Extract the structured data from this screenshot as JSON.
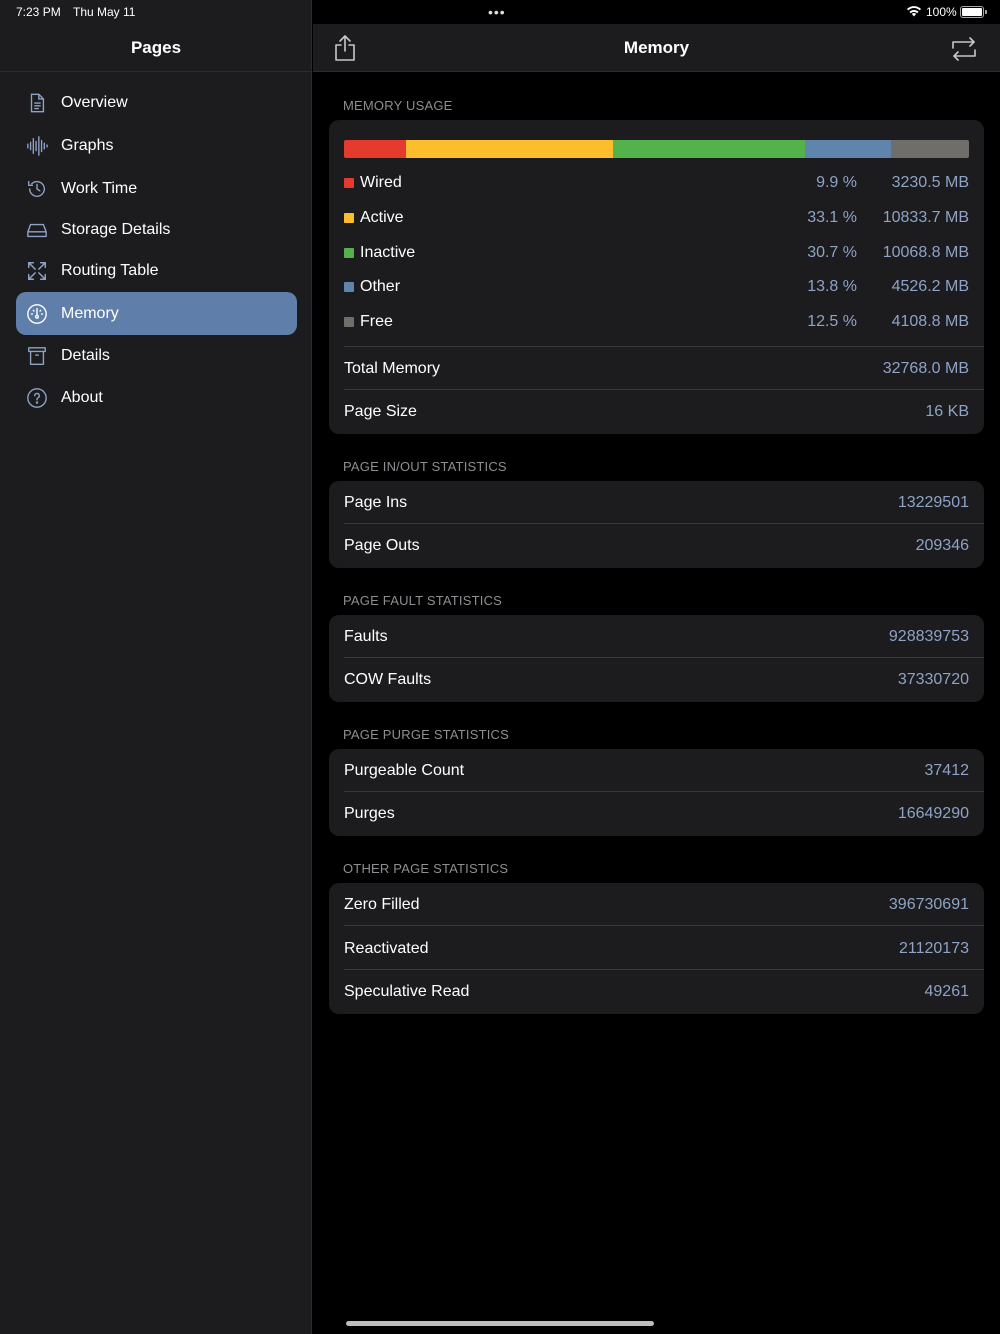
{
  "status_bar": {
    "time": "7:23 PM",
    "date": "Thu May 11",
    "battery": "100%"
  },
  "sidebar": {
    "title": "Pages",
    "items": [
      {
        "label": "Overview",
        "icon": "document-icon",
        "selected": false
      },
      {
        "label": "Graphs",
        "icon": "waveform-icon",
        "selected": false
      },
      {
        "label": "Work Time",
        "icon": "clock-history-icon",
        "selected": false
      },
      {
        "label": "Storage Details",
        "icon": "drive-icon",
        "selected": false
      },
      {
        "label": "Routing Table",
        "icon": "arrows-expand-icon",
        "selected": false
      },
      {
        "label": "Memory",
        "icon": "gauge-icon",
        "selected": true
      },
      {
        "label": "Details",
        "icon": "archive-box-icon",
        "selected": false
      },
      {
        "label": "About",
        "icon": "question-circle-icon",
        "selected": false
      }
    ]
  },
  "main": {
    "title": "Memory",
    "memory_usage": {
      "section": "MEMORY USAGE",
      "bar": [
        {
          "name": "Wired",
          "fraction": 0.099,
          "color": "#e53a2e"
        },
        {
          "name": "Active",
          "fraction": 0.331,
          "color": "#fcbe2d"
        },
        {
          "name": "Inactive",
          "fraction": 0.307,
          "color": "#53b24a"
        },
        {
          "name": "Other",
          "fraction": 0.138,
          "color": "#6085ad"
        },
        {
          "name": "Free",
          "fraction": 0.125,
          "color": "#6f6e6a"
        }
      ],
      "legend": [
        {
          "name": "Wired",
          "pct": "9.9 %",
          "mb": "3230.5 MB"
        },
        {
          "name": "Active",
          "pct": "33.1 %",
          "mb": "10833.7 MB"
        },
        {
          "name": "Inactive",
          "pct": "30.7 %",
          "mb": "10068.8 MB"
        },
        {
          "name": "Other",
          "pct": "13.8 %",
          "mb": "4526.2 MB"
        },
        {
          "name": "Free",
          "pct": "12.5 %",
          "mb": "4108.8 MB"
        }
      ],
      "total_label": "Total Memory",
      "total_value": "32768.0 MB",
      "page_size_label": "Page Size",
      "page_size_value": "16 KB"
    },
    "page_inout": {
      "section": "PAGE IN/OUT STATISTICS",
      "rows": [
        {
          "label": "Page Ins",
          "value": "13229501"
        },
        {
          "label": "Page Outs",
          "value": "209346"
        }
      ]
    },
    "page_fault": {
      "section": "PAGE FAULT STATISTICS",
      "rows": [
        {
          "label": "Faults",
          "value": "928839753"
        },
        {
          "label": "COW Faults",
          "value": "37330720"
        }
      ]
    },
    "page_purge": {
      "section": "PAGE PURGE STATISTICS",
      "rows": [
        {
          "label": "Purgeable Count",
          "value": "37412"
        },
        {
          "label": "Purges",
          "value": "16649290"
        }
      ]
    },
    "other_page": {
      "section": "OTHER PAGE STATISTICS",
      "rows": [
        {
          "label": "Zero Filled",
          "value": "396730691"
        },
        {
          "label": "Reactivated",
          "value": "21120173"
        },
        {
          "label": "Speculative Read",
          "value": "49261"
        }
      ]
    }
  }
}
